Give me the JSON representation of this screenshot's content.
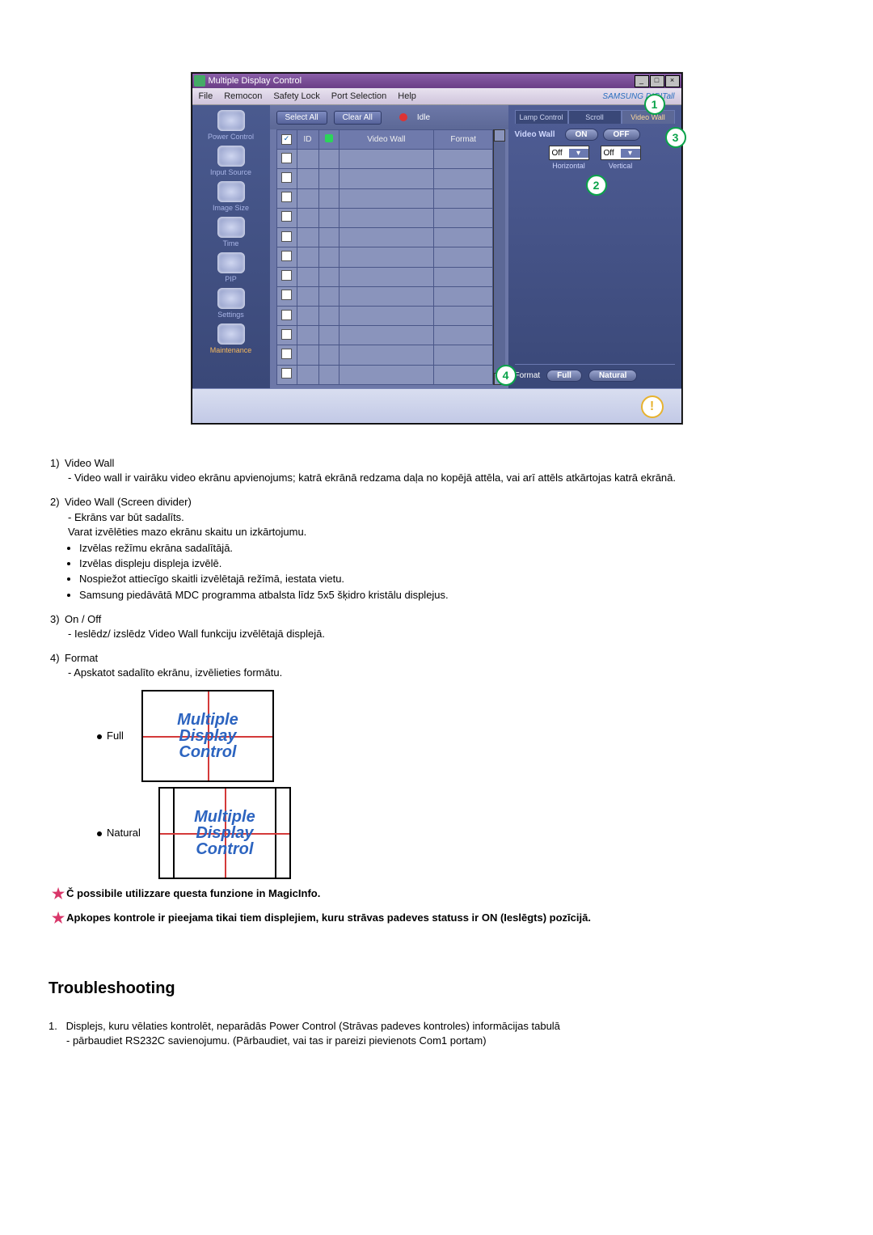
{
  "app": {
    "title": "Multiple Display Control",
    "brand": "SAMSUNG DIGITall"
  },
  "menu": {
    "file": "File",
    "remocon": "Remocon",
    "safety_lock": "Safety Lock",
    "port_selection": "Port Selection",
    "help": "Help"
  },
  "sidebar": {
    "items": [
      {
        "label": "Power Control"
      },
      {
        "label": "Input Source"
      },
      {
        "label": "Image Size"
      },
      {
        "label": "Time"
      },
      {
        "label": "PIP"
      },
      {
        "label": "Settings"
      },
      {
        "label": "Maintenance"
      }
    ]
  },
  "toolbar": {
    "select_all": "Select All",
    "clear_all": "Clear All",
    "idle": "Idle"
  },
  "grid": {
    "col_checkbox": "",
    "col_id": "ID",
    "col_power": "",
    "col_videowall": "Video Wall",
    "col_format": "Format"
  },
  "right": {
    "tabs": {
      "lamp": "Lamp Control",
      "scroll": "Scroll",
      "videowall": "Video Wall"
    },
    "videowall_label": "Video Wall",
    "on": "ON",
    "off": "OFF",
    "horiz_value": "Off",
    "vert_value": "Off",
    "horiz_caption": "Horizontal",
    "vert_caption": "Vertical",
    "format_label": "Format",
    "format_full": "Full",
    "format_natural": "Natural"
  },
  "callouts": {
    "c1": "1",
    "c2": "2",
    "c3": "3",
    "c4": "4"
  },
  "doc": {
    "item1_no": "1)",
    "item1_title": "Video Wall",
    "item1_text": "Video wall ir vairāku video ekrānu apvienojums; katrā ekrānā redzama daļa no kopējā attēla, vai arī attēls atkārtojas katrā ekrānā.",
    "item2_no": "2)",
    "item2_title": "Video Wall (Screen divider)",
    "item2_line1": "Ekrāns var būt sadalīts.",
    "item2_line2": "Varat izvēlēties mazo ekrānu skaitu un izkārtojumu.",
    "item2_b1": "Izvēlas režīmu ekrāna sadalītājā.",
    "item2_b2": "Izvēlas displeju displeja izvēlē.",
    "item2_b3": "Nospiežot attiecīgo skaitli izvēlētajā režīmā, iestata vietu.",
    "item2_b4": "Samsung piedāvātā MDC programma atbalsta līdz 5x5 šķidro kristālu displejus.",
    "item3_no": "3)",
    "item3_title": "On / Off",
    "item3_text": "Ieslēdz/ izslēdz Video Wall funkciju izvēlētajā displejā.",
    "item4_no": "4)",
    "item4_title": "Format",
    "item4_text": "Apskatot sadalīto ekrānu, izvēlieties formātu.",
    "full_label": "Full",
    "natural_label": "Natural",
    "splash_text": "Multiple\nDisplay\nControl",
    "note1": "Č possibile utilizzare questa funzione in MagicInfo.",
    "note2": "Apkopes kontrole ir pieejama tikai tiem displejiem, kuru strāvas padeves statuss ir ON (Ieslēgts) pozīcijā.",
    "ts_heading": "Troubleshooting",
    "ts1_no": "1.",
    "ts1_text": "Displejs, kuru vēlaties kontrolēt, neparādās Power Control (Strāvas padeves kontroles) informācijas tabulā",
    "ts1_sub": "pārbaudiet RS232C savienojumu. (Pārbaudiet, vai tas ir pareizi pievienots Com1 portam)"
  }
}
